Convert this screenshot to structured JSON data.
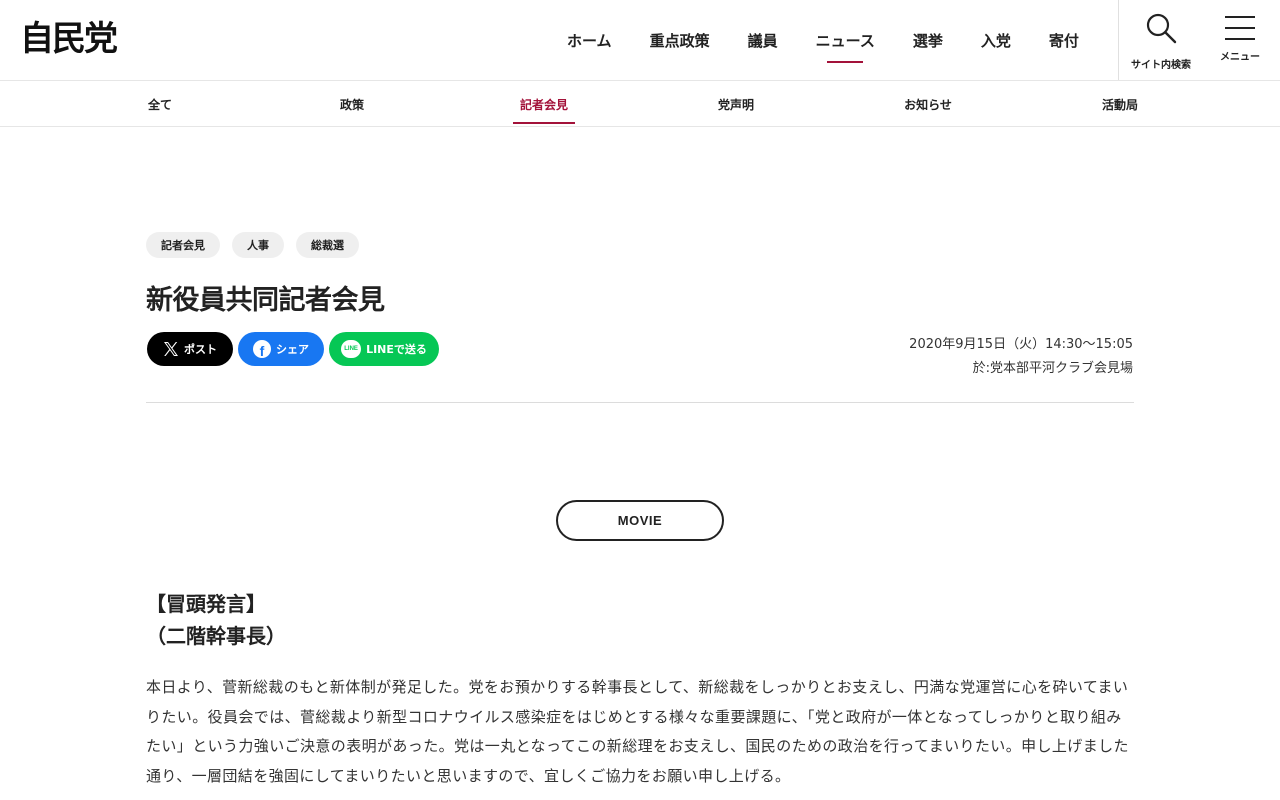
{
  "header": {
    "logo_text": "自民党",
    "nav": [
      {
        "label": "ホーム"
      },
      {
        "label": "重点政策"
      },
      {
        "label": "議員"
      },
      {
        "label": "ニュース",
        "active": true
      },
      {
        "label": "選挙"
      },
      {
        "label": "入党"
      },
      {
        "label": "寄付"
      }
    ],
    "search_label": "サイト内検索",
    "menu_label": "メニュー"
  },
  "subnav": {
    "items": [
      {
        "label": "全て"
      },
      {
        "label": "政策"
      },
      {
        "label": "記者会見",
        "active": true
      },
      {
        "label": "党声明"
      },
      {
        "label": "お知らせ"
      },
      {
        "label": "活動局"
      }
    ]
  },
  "article": {
    "tags": [
      "記者会見",
      "人事",
      "総裁選"
    ],
    "title": "新役員共同記者会見",
    "share": {
      "x_label": "ポスト",
      "facebook_label": "シェア",
      "line_label": "LINEで送る",
      "line_icon_text": "LINE"
    },
    "date": "2020年9月15日（火）14:30～15:05",
    "location": "於:党本部平河クラブ会見場",
    "movie_label": "MOVIE",
    "section_heading_1": "【冒頭発言】",
    "section_heading_2": "（二階幹事長）",
    "body": "本日より、菅新総裁のもと新体制が発足した。党をお預かりする幹事長として、新総裁をしっかりとお支えし、円満な党運営に心を砕いてまいりたい。役員会では、菅総裁より新型コロナウイルス感染症をはじめとする様々な重要課題に、「党と政府が一体となってしっかりと取り組みたい」という力強いご決意の表明があった。党は一丸となってこの新総理をお支えし、国民のための政治を行ってまいりたい。申し上げました通り、一層団結を強固にしてまいりたいと思いますので、宜しくご協力をお願い申し上げる。"
  },
  "colors": {
    "accent": "#a3123a",
    "x_black": "#000000",
    "facebook_blue": "#1877f2",
    "line_green": "#06c755"
  }
}
